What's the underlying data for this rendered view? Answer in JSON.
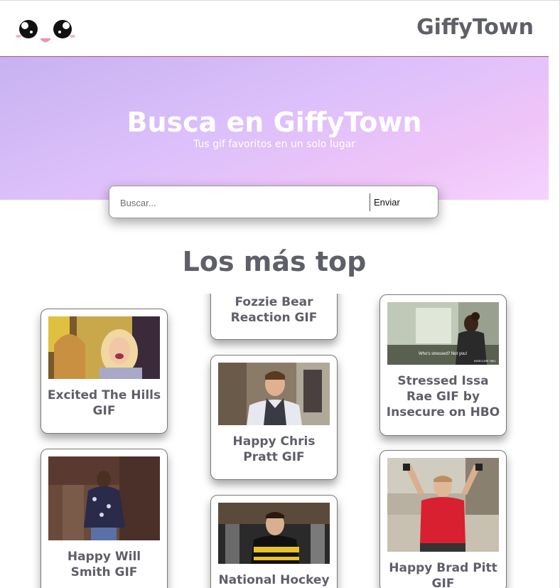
{
  "header": {
    "brand": "GiffyTown"
  },
  "hero": {
    "title": "Busca en GiffyTown",
    "subtitle": "Tus gif favoritos en un solo lugar"
  },
  "search": {
    "placeholder": "Buscar...",
    "value": "",
    "button_label": "Enviar"
  },
  "section": {
    "title": "Los más top"
  },
  "gifs": [
    {
      "title": "Fozzie Bear Reaction GIF"
    },
    {
      "title": "Excited The Hills GIF"
    },
    {
      "title": "Happy Chris Pratt GIF"
    },
    {
      "title": "Stressed Issa Rae GIF by Insecure on HBO"
    },
    {
      "title": "Happy Will Smith GIF"
    },
    {
      "title": "National Hockey"
    },
    {
      "title": "Happy Brad Pitt GIF"
    }
  ],
  "gif_image_texts": {
    "insecure_caption": "Who's stressed? Not you!",
    "insecure_logo": "INSECURE HBO"
  },
  "colors": {
    "brand_text": "#5f5f69",
    "header_border": "#b4508c",
    "hero_gradient_start": "#c7b2f0",
    "hero_gradient_end": "#f5d3fd"
  }
}
